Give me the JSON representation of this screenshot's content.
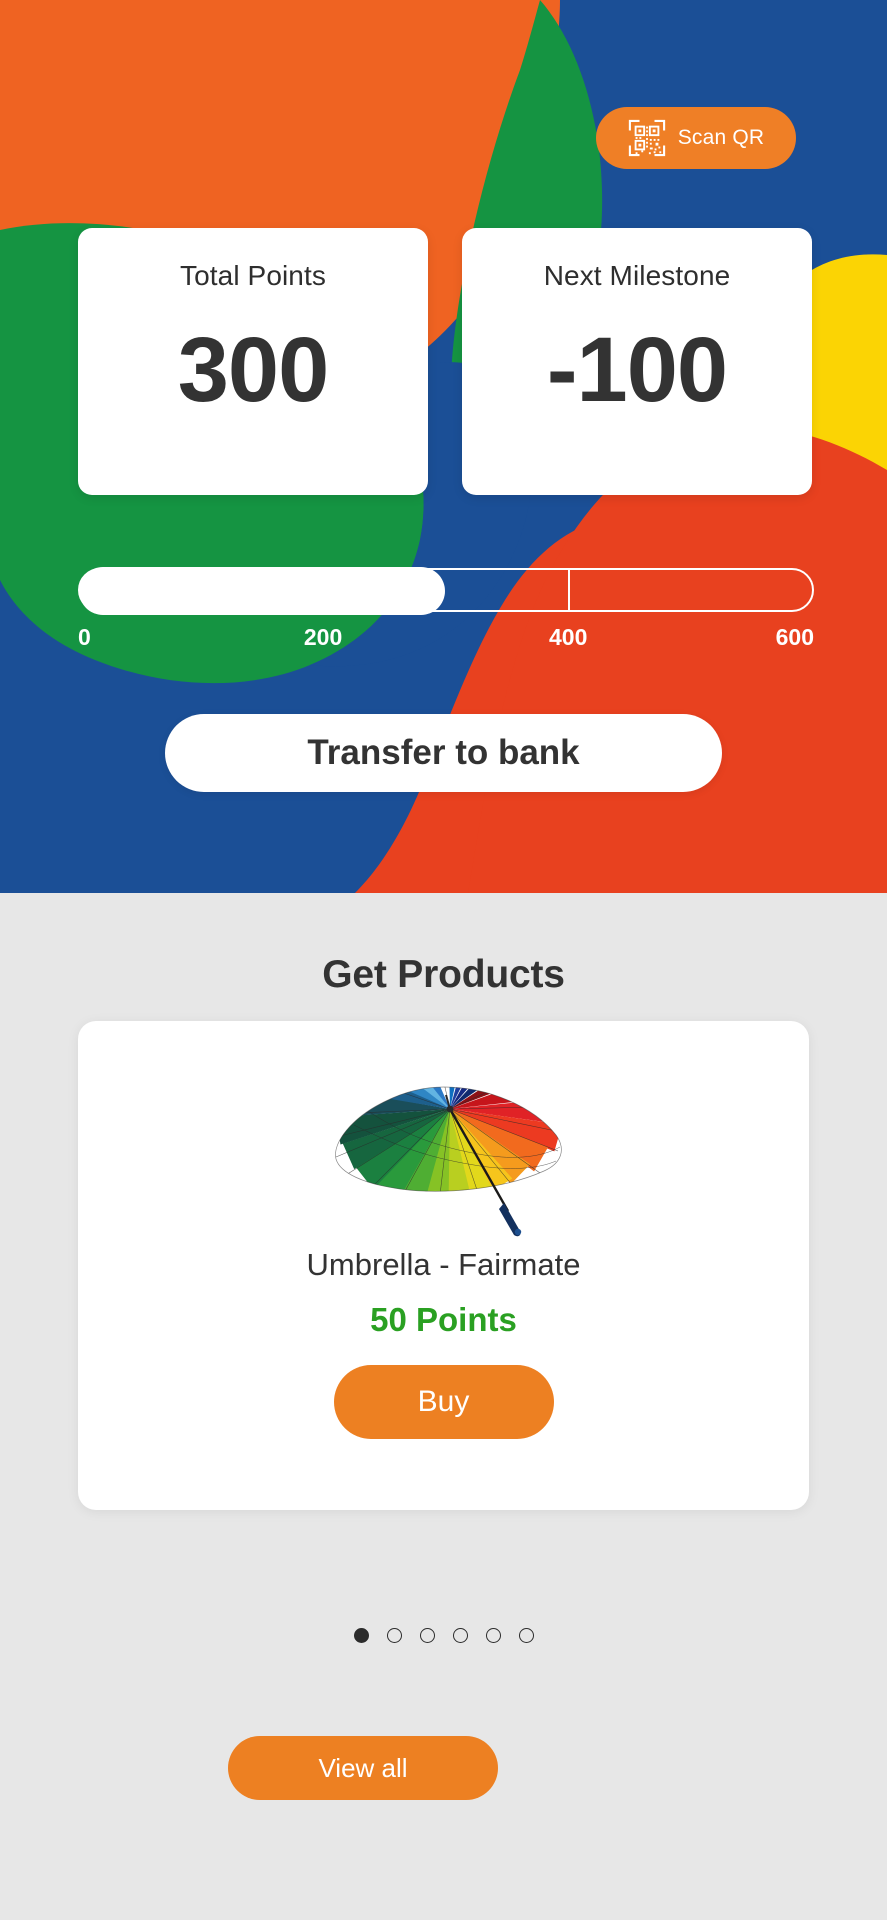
{
  "theme": {
    "orange": "#ef6322",
    "orange_button": "#ed8022",
    "green": "#159442",
    "blue": "#1b4f96",
    "yellow": "#fbd404",
    "red": "#e8411f",
    "points_green": "#2aa022",
    "card_white": "#ffffff",
    "page_grey": "#e7e7e7",
    "text_dark": "#333333"
  },
  "hero": {
    "scan_qr": {
      "label": "Scan QR",
      "icon": "qr-code-scan-icon"
    },
    "stats": [
      {
        "label": "Total Points",
        "value": "300"
      },
      {
        "label": "Next Milestone",
        "value": "-100"
      }
    ],
    "progress": {
      "value": 300,
      "min": 0,
      "max": 600,
      "fill_percent": 50,
      "ticks": [
        "0",
        "200",
        "400",
        "600"
      ],
      "tick_positions": [
        0,
        33.3,
        66.6,
        100
      ]
    },
    "transfer_button": {
      "label": "Transfer to bank"
    }
  },
  "products": {
    "title": "Get Products",
    "items": [
      {
        "image": "rainbow-umbrella-photo",
        "name": "Umbrella - Fairmate",
        "points": "50 Points",
        "buy_label": "Buy"
      }
    ],
    "carousel": {
      "total_dots": 6,
      "active_index": 0
    },
    "view_all_button": {
      "label": "View all"
    }
  }
}
